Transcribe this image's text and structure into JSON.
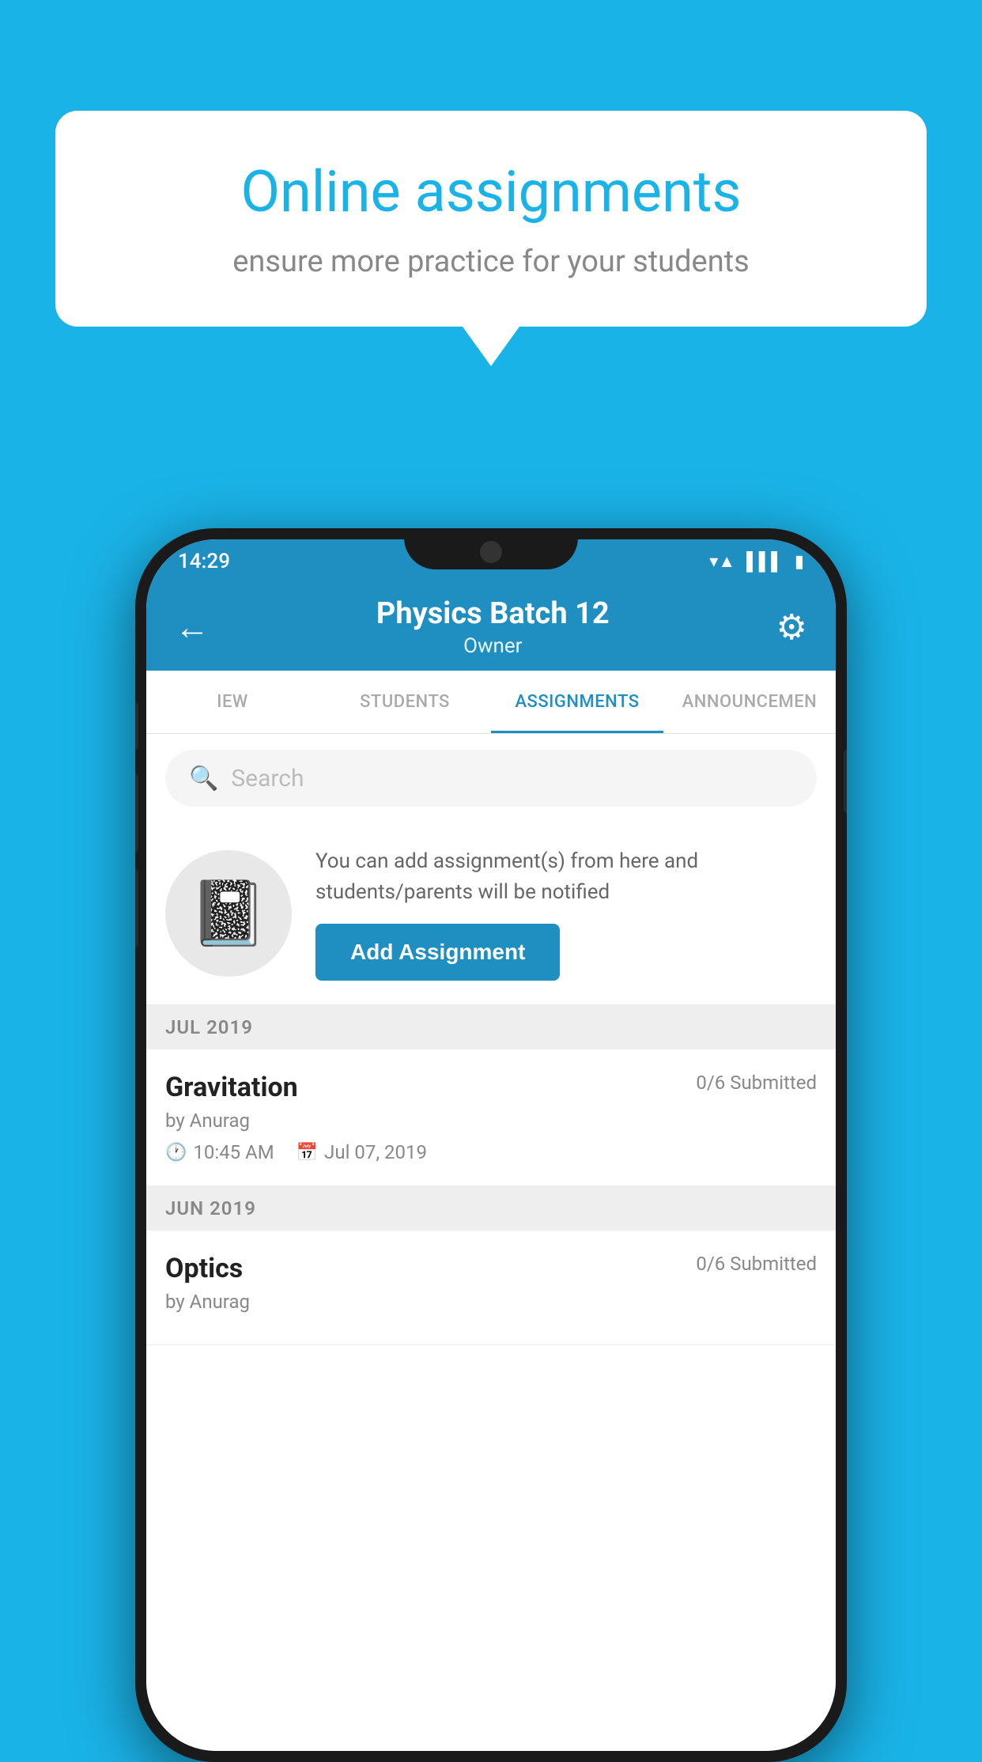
{
  "background": {
    "color": "#1ab3e8"
  },
  "info_card": {
    "title": "Online assignments",
    "subtitle": "ensure more practice for your students"
  },
  "status_bar": {
    "time": "14:29",
    "wifi_icon": "wifi",
    "signal_icon": "signal",
    "battery_icon": "battery"
  },
  "app_bar": {
    "back_icon": "←",
    "title": "Physics Batch 12",
    "subtitle": "Owner",
    "settings_icon": "⚙"
  },
  "tabs": [
    {
      "label": "IEW",
      "active": false
    },
    {
      "label": "STUDENTS",
      "active": false
    },
    {
      "label": "ASSIGNMENTS",
      "active": true
    },
    {
      "label": "ANNOUNCEMENTS",
      "active": false
    }
  ],
  "search": {
    "placeholder": "Search"
  },
  "add_assignment": {
    "description": "You can add assignment(s) from here and students/parents will be notified",
    "button_label": "Add Assignment"
  },
  "sections": [
    {
      "month": "JUL 2019",
      "assignments": [
        {
          "name": "Gravitation",
          "submitted": "0/6 Submitted",
          "by": "by Anurag",
          "time": "10:45 AM",
          "date": "Jul 07, 2019"
        }
      ]
    },
    {
      "month": "JUN 2019",
      "assignments": [
        {
          "name": "Optics",
          "submitted": "0/6 Submitted",
          "by": "by Anurag",
          "time": "",
          "date": ""
        }
      ]
    }
  ]
}
